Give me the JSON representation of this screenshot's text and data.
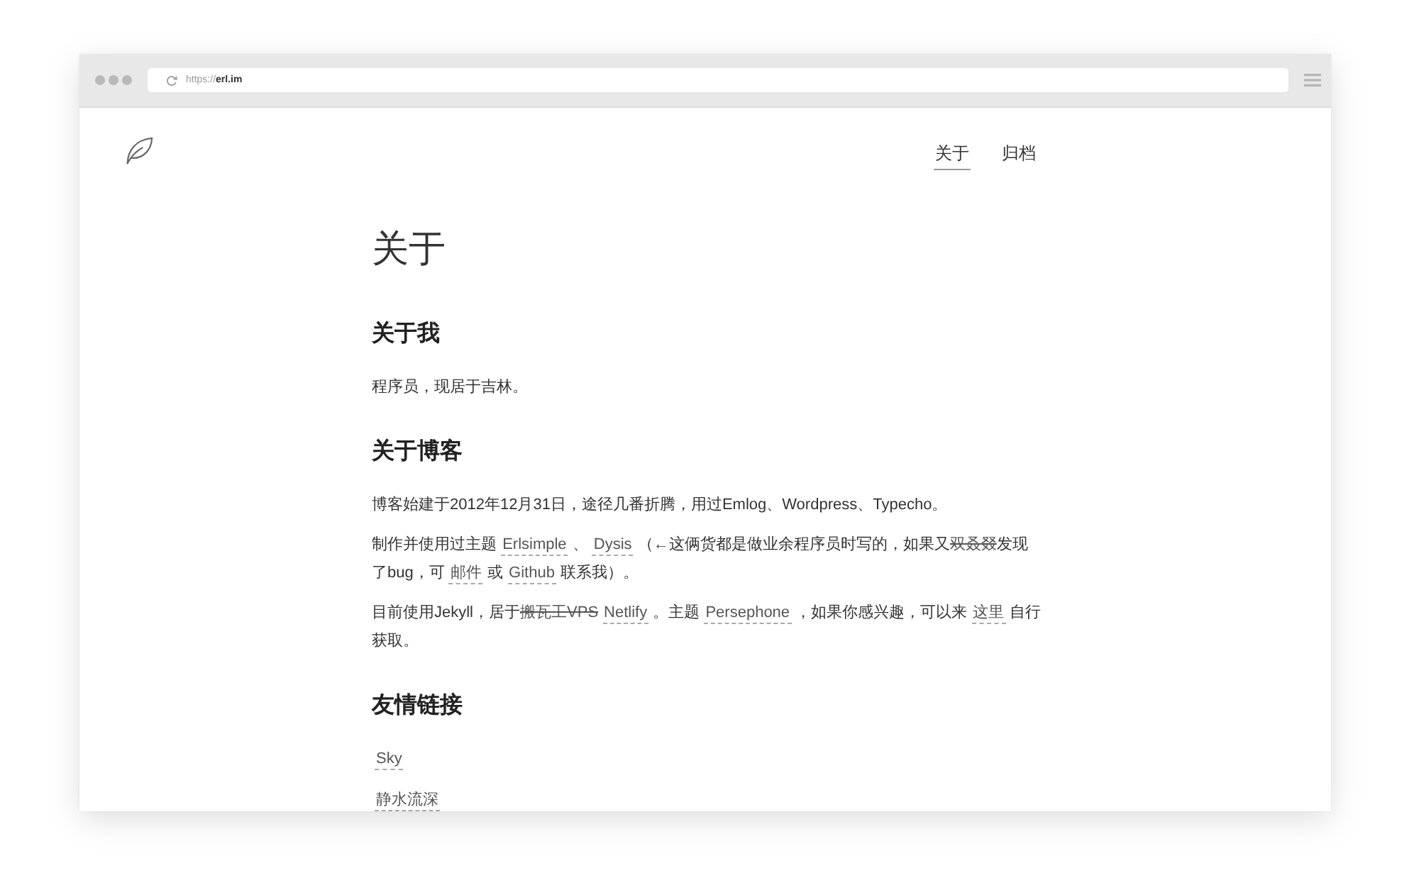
{
  "browser": {
    "url": "https://**erl.im**"
  },
  "site": {
    "nav": [
      {
        "label": "关于",
        "selected": true
      },
      {
        "label": "归档",
        "selected": false
      }
    ]
  },
  "page": {
    "title": "关于",
    "sections": [
      {
        "heading": "关于我",
        "paragraphs": [
          [
            {
              "kind": "text",
              "text": "程序员，现居于吉林。"
            }
          ]
        ]
      },
      {
        "heading": "关于博客",
        "paragraphs": [
          [
            {
              "kind": "text",
              "text": "博客始建于2012年12月31日，途径几番折腾，用过Emlog、Wordpress、Typecho。"
            }
          ],
          [
            {
              "kind": "text",
              "text": "制作并使用过主题 "
            },
            {
              "kind": "link",
              "text": "Erlsimple"
            },
            {
              "kind": "text",
              "text": " 、 "
            },
            {
              "kind": "link",
              "text": "Dysis"
            },
            {
              "kind": "text",
              "text": " （←这俩货都是做业余程序员时写的，如果又"
            },
            {
              "kind": "strike",
              "text": "双叒叕"
            },
            {
              "kind": "text",
              "text": "发现了bug，可 "
            },
            {
              "kind": "link",
              "text": "邮件"
            },
            {
              "kind": "text",
              "text": " 或 "
            },
            {
              "kind": "link",
              "text": "Github"
            },
            {
              "kind": "text",
              "text": " 联系我）。"
            }
          ],
          [
            {
              "kind": "text",
              "text": "目前使用Jekyll，居于"
            },
            {
              "kind": "strike",
              "text": "搬瓦工VPS"
            },
            {
              "kind": "link",
              "text": "Netlify"
            },
            {
              "kind": "text",
              "text": " 。主题 "
            },
            {
              "kind": "link",
              "text": "Persephone"
            },
            {
              "kind": "text",
              "text": " ，如果你感兴趣，可以来 "
            },
            {
              "kind": "link",
              "text": "这里"
            },
            {
              "kind": "text",
              "text": " 自行获取。"
            }
          ]
        ]
      },
      {
        "heading": "友情链接",
        "links": [
          "Sky",
          "静水流深"
        ]
      }
    ]
  }
}
